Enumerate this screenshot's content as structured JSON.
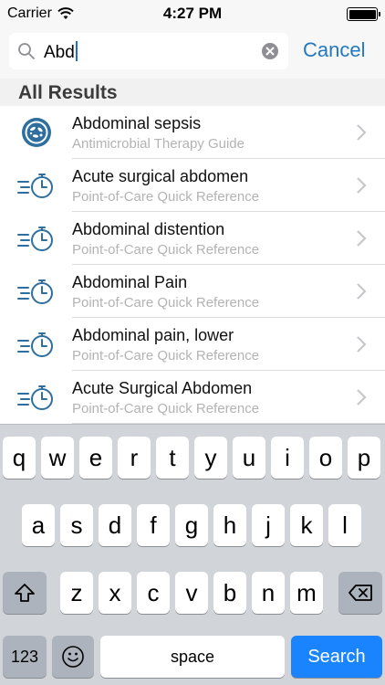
{
  "status_bar": {
    "carrier": "Carrier",
    "time": "4:27 PM"
  },
  "search": {
    "value": "Abd",
    "cancel_label": "Cancel"
  },
  "section": {
    "title": "All Results"
  },
  "results": [
    {
      "title": "Abdominal sepsis",
      "subtitle": "Antimicrobial Therapy Guide",
      "icon": "bacteria-icon"
    },
    {
      "title": "Acute surgical abdomen",
      "subtitle": "Point-of-Care Quick Reference",
      "icon": "quick-reference-icon"
    },
    {
      "title": "Abdominal distention",
      "subtitle": "Point-of-Care Quick Reference",
      "icon": "quick-reference-icon"
    },
    {
      "title": "Abdominal Pain",
      "subtitle": "Point-of-Care Quick Reference",
      "icon": "quick-reference-icon"
    },
    {
      "title": "Abdominal pain, lower",
      "subtitle": "Point-of-Care Quick Reference",
      "icon": "quick-reference-icon"
    },
    {
      "title": "Acute Surgical Abdomen",
      "subtitle": "Point-of-Care Quick Reference",
      "icon": "quick-reference-icon"
    }
  ],
  "keyboard": {
    "row1": [
      "q",
      "w",
      "e",
      "r",
      "t",
      "y",
      "u",
      "i",
      "o",
      "p"
    ],
    "row2": [
      "a",
      "s",
      "d",
      "f",
      "g",
      "h",
      "j",
      "k",
      "l"
    ],
    "row3": [
      "z",
      "x",
      "c",
      "v",
      "b",
      "n",
      "m"
    ],
    "numbers_label": "123",
    "space_label": "space",
    "search_label": "Search"
  },
  "colors": {
    "accent": "#2478bf",
    "search_key": "#1a84ff",
    "icon": "#2e6f9e"
  }
}
